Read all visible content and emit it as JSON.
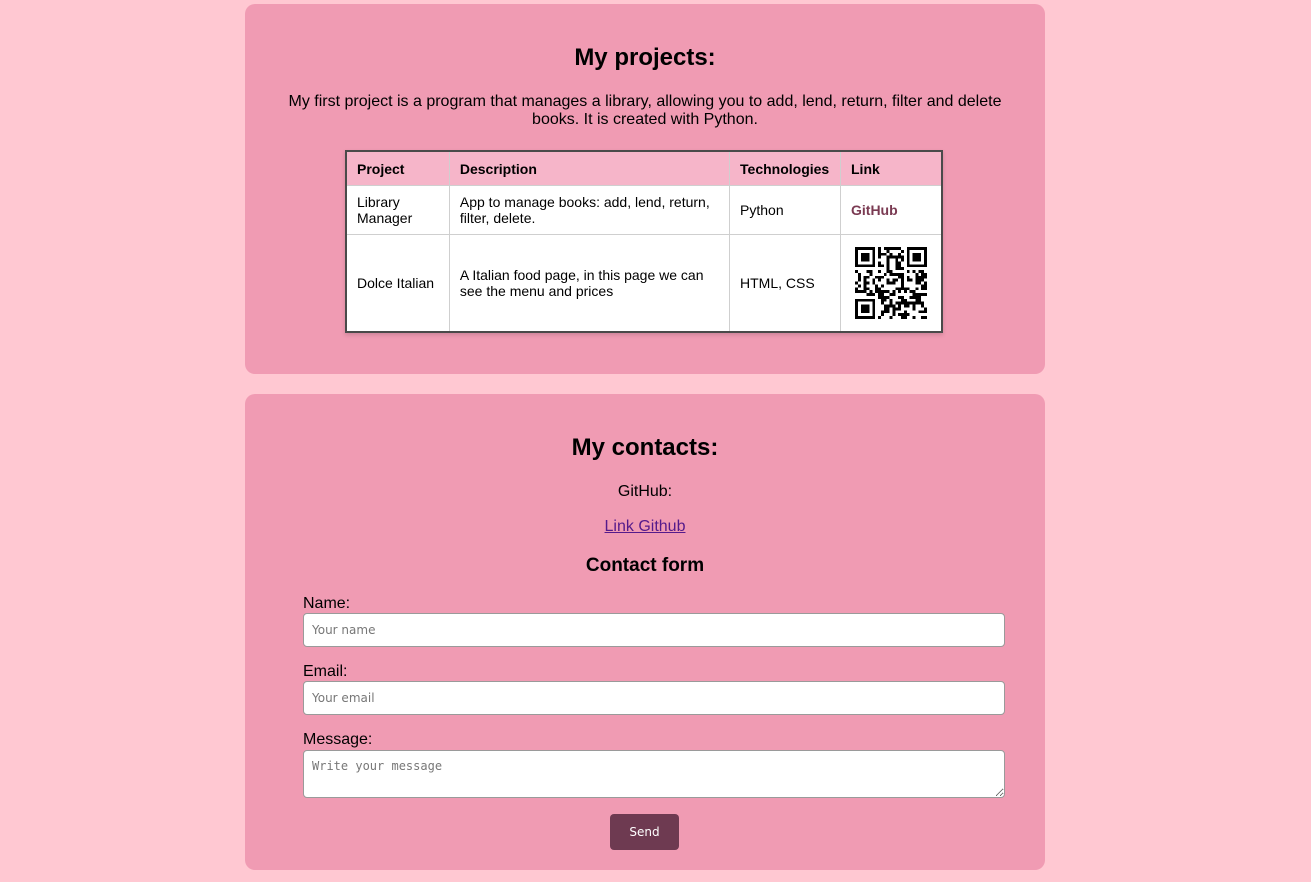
{
  "projects": {
    "title": "My projects:",
    "intro": "My first project is a program that manages a library, allowing you to add, lend, return, filter and delete books. It is created with Python.",
    "table": {
      "headers": [
        "Project",
        "Description",
        "Technologies",
        "Link"
      ],
      "rows": [
        {
          "project": "Library Manager",
          "description": "App to manage books: add, lend, return, filter, delete.",
          "technologies": "Python",
          "link_text": "GitHub"
        },
        {
          "project": "Dolce Italian",
          "description": "A Italian food page, in this page we can see the menu and prices",
          "technologies": "HTML, CSS",
          "link_icon": "qr-code-icon"
        }
      ]
    }
  },
  "contacts": {
    "title": "My contacts:",
    "github_label": "GitHub:",
    "github_link_text": "Link Github",
    "form": {
      "title": "Contact form",
      "name_label": "Name:",
      "name_placeholder": "Your name",
      "email_label": "Email:",
      "email_placeholder": "Your email",
      "message_label": "Message:",
      "message_placeholder": "Write your message",
      "send_label": "Send"
    }
  },
  "colors": {
    "page_background": "#ffc8d2",
    "card_background": "#f09bb3",
    "table_header": "#f6b5c9",
    "button": "#6e3a51",
    "github_link": "#7a3a52"
  }
}
